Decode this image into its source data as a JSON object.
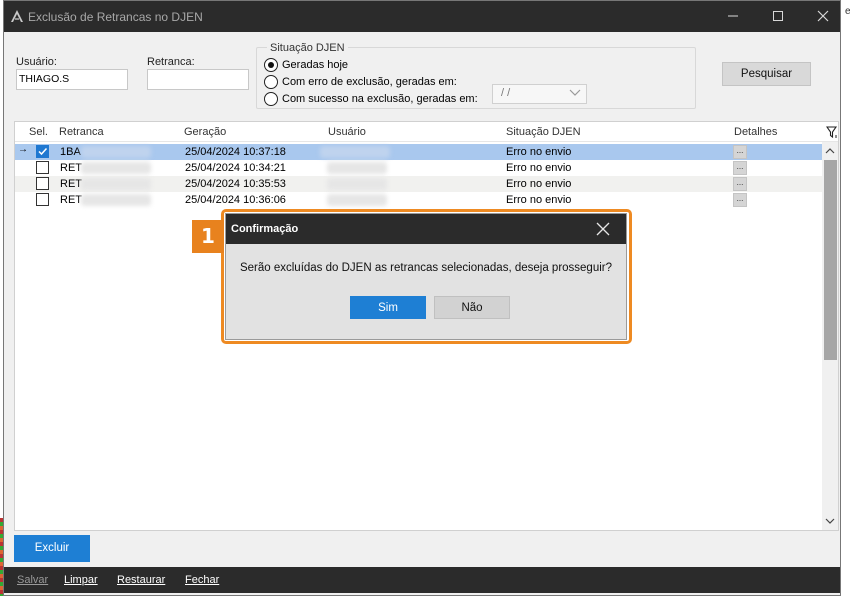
{
  "window": {
    "title": "Exclusão de Retrancas no DJEN"
  },
  "filters": {
    "usuario_label": "Usuário:",
    "usuario_value": "THIAGO.S",
    "retranca_label": "Retranca:",
    "retranca_value": "",
    "situacao_label": "Situação DJEN",
    "options": [
      {
        "label": "Geradas hoje",
        "selected": true
      },
      {
        "label": "Com erro de exclusão, geradas em:",
        "selected": false
      },
      {
        "label": "Com sucesso na exclusão, geradas em:",
        "selected": false
      }
    ],
    "date_value": "/ /",
    "search_label": "Pesquisar"
  },
  "grid": {
    "columns": [
      "Sel.",
      "Retranca",
      "Geração",
      "Usuário",
      "Situação DJEN",
      "Detalhes"
    ],
    "rows": [
      {
        "current": true,
        "checked": true,
        "retranca": "1BA",
        "geracao": "25/04/2024 10:37:18",
        "situacao": "Erro no envio",
        "detalhes": "..."
      },
      {
        "current": false,
        "checked": false,
        "retranca": "RET",
        "geracao": "25/04/2024 10:34:21",
        "situacao": "Erro no envio",
        "detalhes": "..."
      },
      {
        "current": false,
        "checked": false,
        "retranca": "RET",
        "geracao": "25/04/2024 10:35:53",
        "situacao": "Erro no envio",
        "detalhes": "..."
      },
      {
        "current": false,
        "checked": false,
        "retranca": "RET",
        "geracao": "25/04/2024 10:36:06",
        "situacao": "Erro no envio",
        "detalhes": "..."
      }
    ]
  },
  "actions": {
    "excluir_label": "Excluir"
  },
  "bottom_bar": {
    "salvar": "Salvar",
    "limpar": "Limpar",
    "restaurar": "Restaurar",
    "fechar": "Fechar"
  },
  "dialog": {
    "title": "Confirmação",
    "message": "Serão excluídas do DJEN as retrancas selecionadas, deseja prosseguir?",
    "yes_label": "Sim",
    "no_label": "Não"
  },
  "annotation": {
    "step": "1"
  },
  "colors": {
    "accent": "#1e7fd4",
    "highlight": "#ee8a22",
    "titlebar": "#2b2b2b",
    "selected_row": "#a9c8ee"
  },
  "icons": {
    "app": "app-icon",
    "minimize": "minimize-icon",
    "maximize": "maximize-icon",
    "close": "close-icon",
    "filter": "filter-icon"
  }
}
